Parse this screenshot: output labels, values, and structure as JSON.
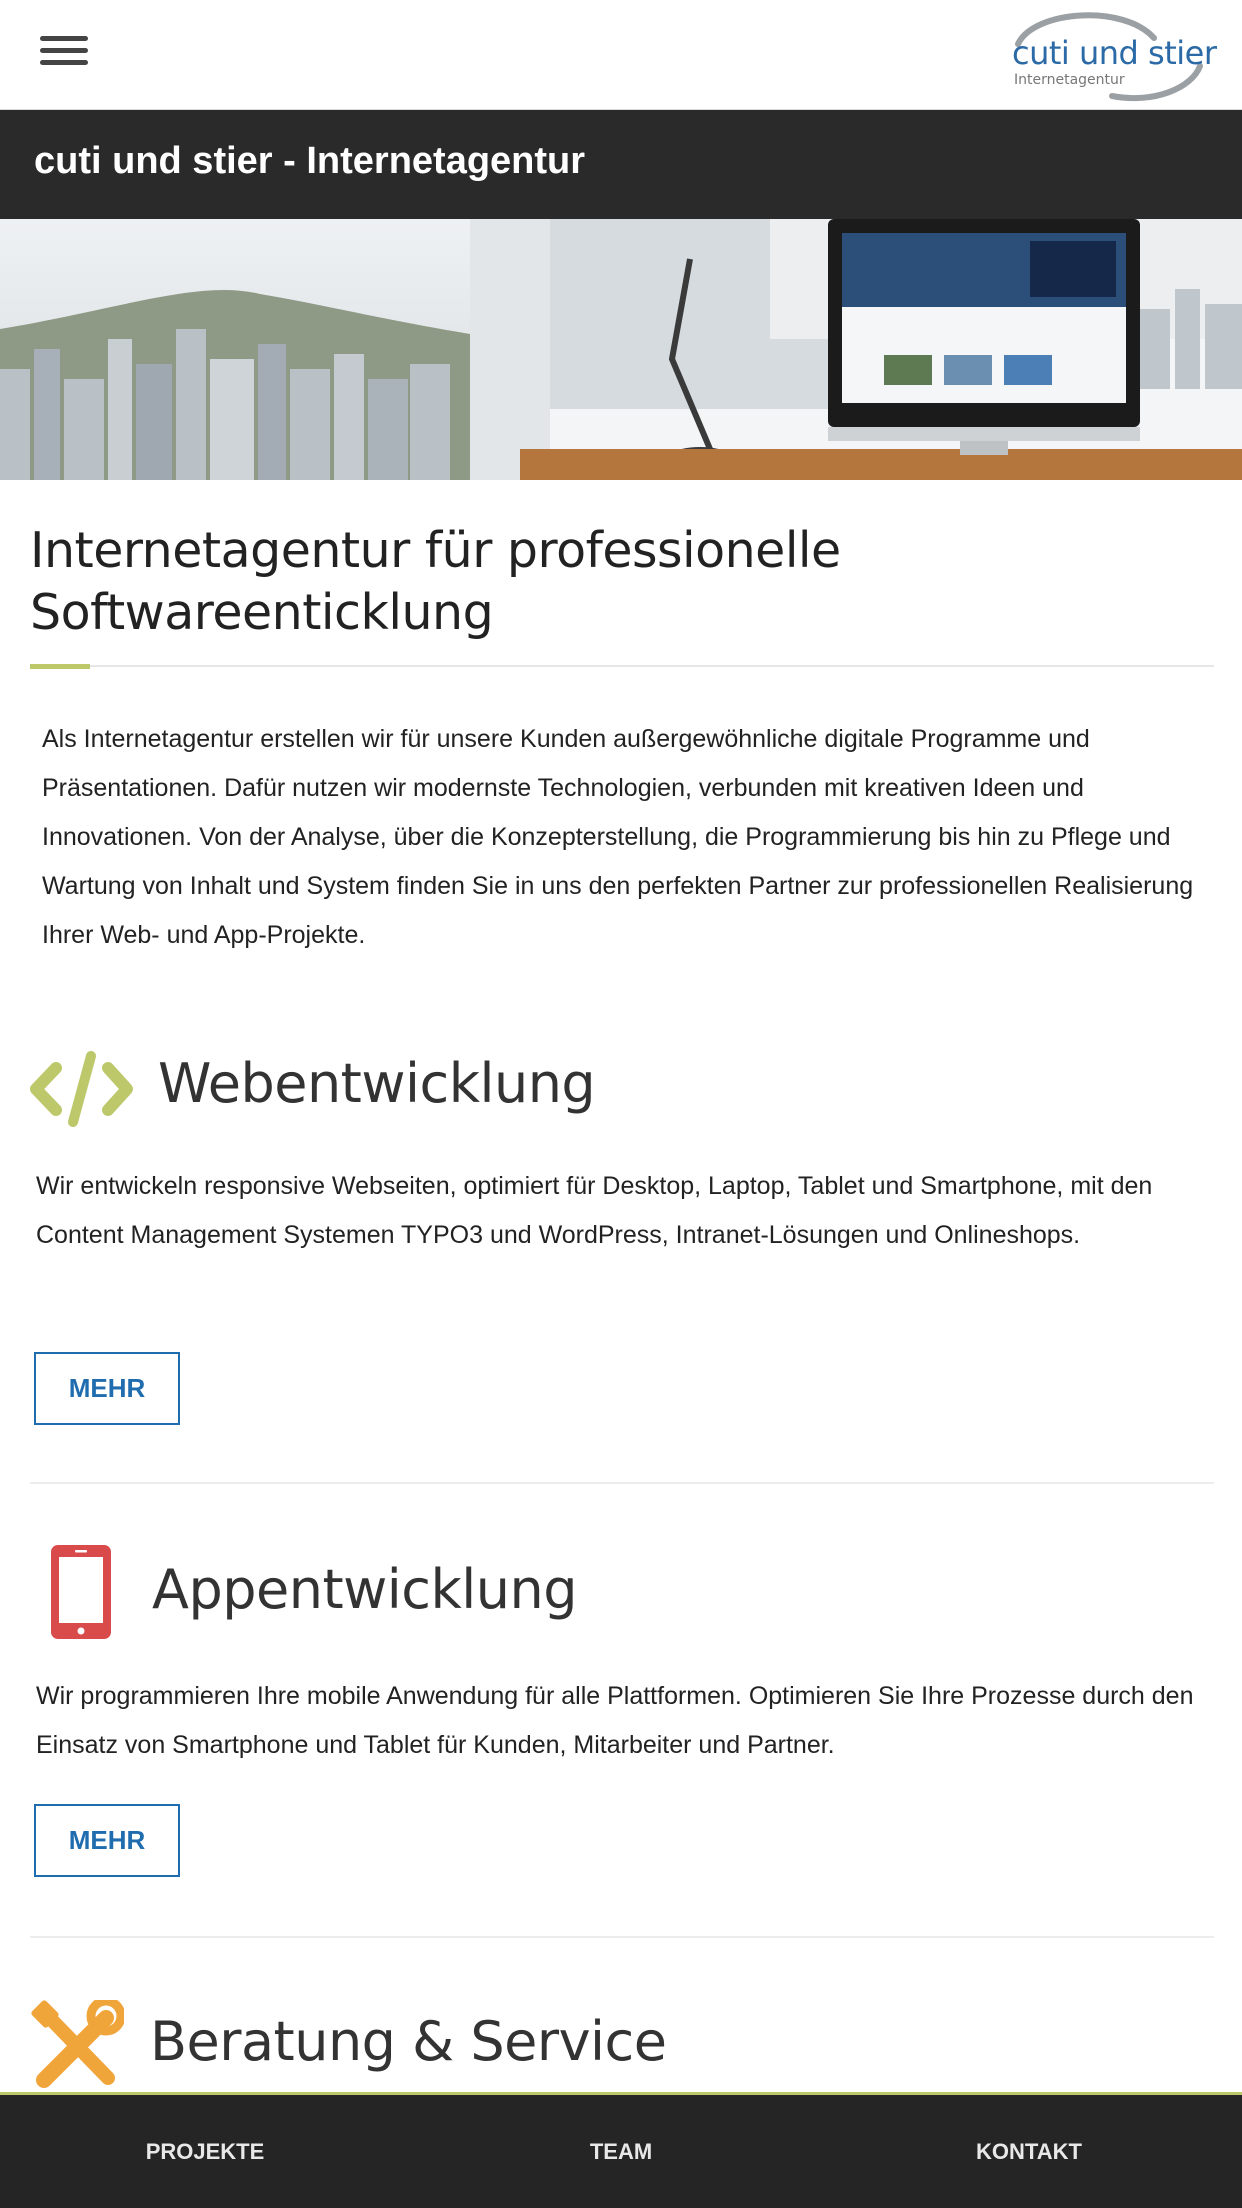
{
  "header": {
    "menu_icon": "hamburger-menu-icon",
    "logo_text": "cuti und stier",
    "logo_subtitle": "Internetagentur",
    "logo_colors": {
      "text": "#2b6aa6",
      "arc": "#9aa0a3"
    }
  },
  "title_bar": {
    "title": "cuti und stier - Internetagentur"
  },
  "intro": {
    "heading_line1": "Internetagentur für professionelle",
    "heading_line2": "Softwareenticklung",
    "text": "Als Internetagentur erstellen wir für unsere Kunden außergewöhnliche digitale Programme und Präsentationen. Dafür nutzen wir modernste Technologien, verbunden mit kreativen Ideen und Innovationen. Von der Analyse, über die Konzepterstellung, die Programmierung bis hin zu Pflege und Wartung von Inhalt und System finden Sie in uns den perfekten Partner zur professionellen Realisierung Ihrer Web- und App-Projekte."
  },
  "sections": [
    {
      "icon": "code-icon",
      "icon_color": "#bcc86a",
      "title": "Webentwicklung",
      "text": "Wir entwickeln responsive Webseiten, optimiert für Desktop, Laptop, Tablet und Smartphone, mit den Content Management Systemen TYPO3 und WordPress, Intranet-Lösungen und Onlineshops.",
      "button": "MEHR"
    },
    {
      "icon": "smartphone-icon",
      "icon_color": "#d94a4a",
      "title": "Appentwicklung",
      "text": "Wir programmieren Ihre mobile Anwendung für alle Plattformen. Optimieren Sie Ihre Prozesse durch den Einsatz von Smartphone und Tablet für Kunden, Mitarbeiter und Partner.",
      "button": "MEHR"
    },
    {
      "icon": "tools-icon",
      "icon_color": "#f0a53a",
      "title": "Beratung & Service"
    }
  ],
  "bottom_nav": {
    "items": [
      "PROJEKTE",
      "TEAM",
      "KONTAKT"
    ],
    "accent": "#bcc86a"
  },
  "colors": {
    "primary_blue": "#1f6cae",
    "dark_bar": "#2a2a2a",
    "accent_green": "#bcc86a"
  }
}
